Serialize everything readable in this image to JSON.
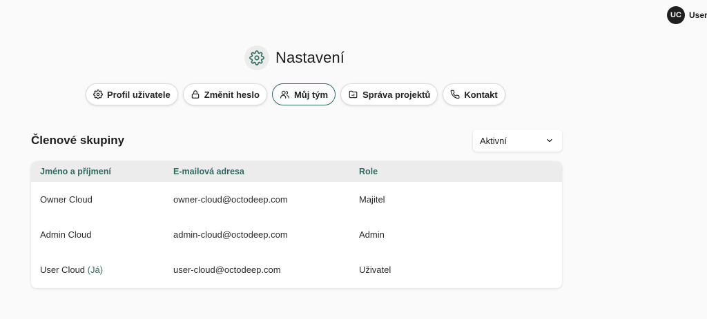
{
  "user": {
    "initials": "UC",
    "name": "User"
  },
  "header": {
    "title": "Nastavení",
    "icon": "gear-icon"
  },
  "tabs": [
    {
      "label": "Profil uživatele",
      "icon": "gear-icon",
      "active": false
    },
    {
      "label": "Změnit heslo",
      "icon": "lock-icon",
      "active": false
    },
    {
      "label": "Můj tým",
      "icon": "users-icon",
      "active": true
    },
    {
      "label": "Správa projektů",
      "icon": "folder-icon",
      "active": false
    },
    {
      "label": "Kontakt",
      "icon": "phone-icon",
      "active": false
    }
  ],
  "section": {
    "title": "Členové skupiny"
  },
  "filter": {
    "selected": "Aktivní",
    "icon": "chevron-down-icon"
  },
  "table": {
    "columns": [
      "Jméno a příjmení",
      "E-mailová adresa",
      "Role"
    ],
    "rows": [
      {
        "name": "Owner Cloud",
        "me_tag": "",
        "email": "owner-cloud@octodeep.com",
        "role": "Majitel"
      },
      {
        "name": "Admin Cloud",
        "me_tag": "",
        "email": "admin-cloud@octodeep.com",
        "role": "Admin"
      },
      {
        "name": "User Cloud",
        "me_tag": "(Já)",
        "email": "user-cloud@octodeep.com",
        "role": "Uživatel"
      }
    ]
  },
  "colors": {
    "accent": "#2f6b5e",
    "header_bg": "#ececec",
    "page_bg": "#fafafa"
  }
}
